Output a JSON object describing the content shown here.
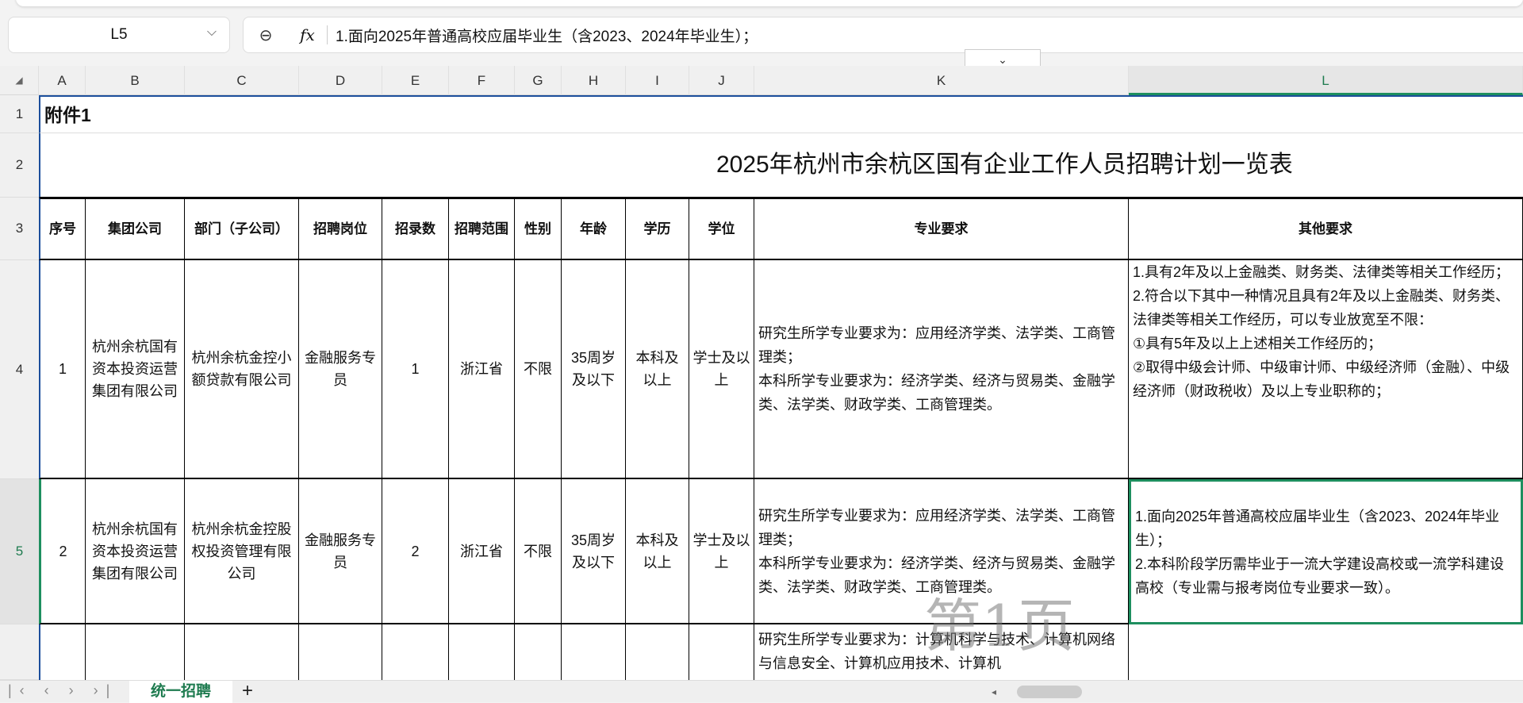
{
  "name_box": "L5",
  "formula": "1.面向2025年普通高校应届毕业生（含2023、2024年毕业生）；",
  "icons": {
    "zoom": "zoom-out-icon",
    "fx": "fx-icon"
  },
  "fx_label": "fx",
  "columns": [
    "A",
    "B",
    "C",
    "D",
    "E",
    "F",
    "G",
    "H",
    "I",
    "J",
    "K",
    "L"
  ],
  "rows": [
    "1",
    "2",
    "3",
    "4",
    "5"
  ],
  "row6": "",
  "attachment": "附件1",
  "title": "2025年杭州市余杭区国有企业工作人员招聘计划一览表",
  "headers": [
    "序号",
    "集团公司",
    "部门（子公司）",
    "招聘岗位",
    "招录数",
    "招聘范围",
    "性别",
    "年龄",
    "学历",
    "学位",
    "专业要求",
    "其他要求"
  ],
  "records": [
    {
      "no": "1",
      "group": "杭州余杭国有资本投资运营集团有限公司",
      "dept": "杭州余杭金控小额贷款有限公司",
      "post": "金融服务专员",
      "count": "1",
      "scope": "浙江省",
      "gender": "不限",
      "age": "35周岁及以下",
      "edu": "本科及以上",
      "degree": "学士及以上",
      "major": "研究生所学专业要求为：应用经济学类、法学类、工商管理类；\n本科所学专业要求为：经济学类、经济与贸易类、金融学类、法学类、财政学类、工商管理类。",
      "other": "1.具有2年及以上金融类、财务类、法律类等相关工作经历；\n2.符合以下其中一种情况且具有2年及以上金融类、财务类、法律类等相关工作经历，可以专业放宽至不限：\n①具有5年及以上上述相关工作经历的；\n②取得中级会计师、中级审计师、中级经济师（金融）、中级经济师（财政税收）及以上专业职称的；"
    },
    {
      "no": "2",
      "group": "杭州余杭国有资本投资运营集团有限公司",
      "dept": "杭州余杭金控股权投资管理有限公司",
      "post": "金融服务专员",
      "count": "2",
      "scope": "浙江省",
      "gender": "不限",
      "age": "35周岁及以下",
      "edu": "本科及以上",
      "degree": "学士及以上",
      "major": "研究生所学专业要求为：应用经济学类、法学类、工商管理类；\n本科所学专业要求为：经济学类、经济与贸易类、金融学类、法学类、财政学类、工商管理类。",
      "other": "1.面向2025年普通高校应届毕业生（含2023、2024年毕业生）；\n2.本科阶段学历需毕业于一流大学建设高校或一流学科建设高校（专业需与报考岗位专业要求一致）。"
    }
  ],
  "partial_row_major": "研究生所学专业要求为：计算机科学与技术、计算机网络与信息安全、计算机应用技术、计算机",
  "watermark": "第1页",
  "sheet_tab": "统一招聘",
  "add_sheet": "+",
  "colors": {
    "accent": "#1e8f5f"
  }
}
